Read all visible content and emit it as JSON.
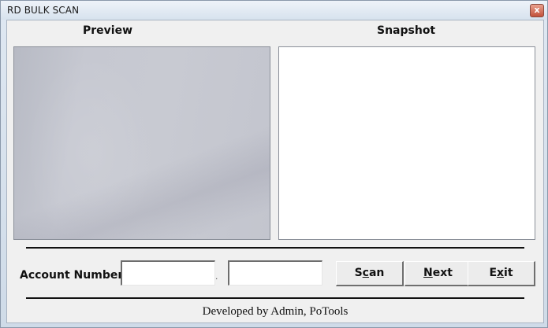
{
  "window": {
    "title": "RD BULK SCAN",
    "close_glyph": "x"
  },
  "panels": {
    "preview_label": "Preview",
    "snapshot_label": "Snapshot"
  },
  "form": {
    "account_label": "Account Number",
    "account_value_1": "",
    "account_value_2": "",
    "separator": "."
  },
  "buttons": {
    "scan": {
      "accel": "S",
      "mid": "c",
      "rest": "an",
      "pre": "S",
      "u": "c",
      "post": "an"
    },
    "next": {
      "pre": "",
      "u": "N",
      "post": "ext"
    },
    "exit": {
      "pre": "E",
      "u": "x",
      "post": "it"
    }
  },
  "footer": {
    "text": "Developed by Admin, PoTools"
  }
}
